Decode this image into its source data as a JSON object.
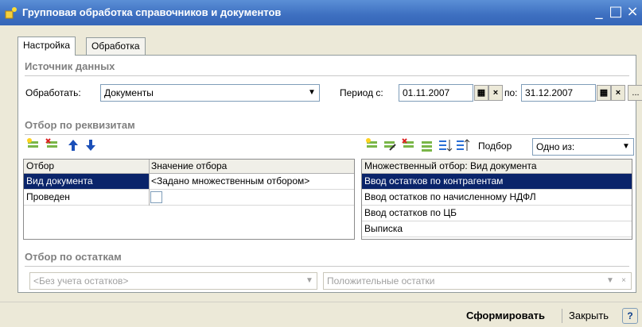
{
  "window": {
    "title": "Групповая обработка справочников и документов",
    "minimize": "_",
    "maximize": "□",
    "close": "×"
  },
  "tabs": [
    {
      "label": "Настройка",
      "active": true
    },
    {
      "label": "Обработка",
      "active": false
    }
  ],
  "source": {
    "section_title": "Источник данных",
    "process_label": "Обработать:",
    "process_value": "Документы",
    "period_from_label": "Период с:",
    "period_from": "01.11.2007",
    "period_to_label": "по:",
    "period_to": "31.12.2007",
    "ellipsis": "..."
  },
  "filter": {
    "section_title": "Отбор по реквизитам",
    "left_columns": [
      "Отбор",
      "Значение отбора"
    ],
    "rows": [
      {
        "name": "Вид документа",
        "value": "<Задано множественным отбором>",
        "selected": true
      },
      {
        "name": "Проведен",
        "value": "",
        "checkbox": true
      }
    ],
    "pick_label": "Подбор",
    "mode_value": "Одно из:",
    "right_header": "Множественный отбор: Вид документа",
    "right_rows": [
      "Ввод остатков по контрагентам",
      "Ввод остатков по начисленному НДФЛ",
      "Ввод остатков по ЦБ",
      "Выписка"
    ]
  },
  "balances": {
    "section_title": "Отбор по остаткам",
    "balance_mode": "<Без учета остатков>",
    "balance_type": "Положительные остатки"
  },
  "footer": {
    "generate": "Сформировать",
    "close": "Закрыть",
    "help": "?"
  }
}
